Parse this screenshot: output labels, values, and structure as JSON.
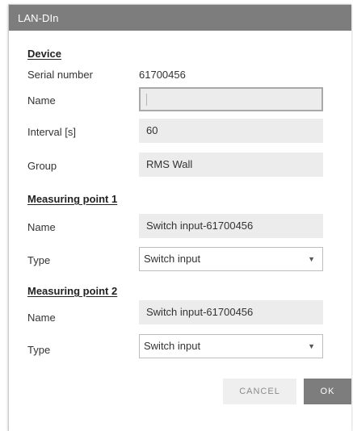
{
  "dialog": {
    "title": "LAN-DIn"
  },
  "device": {
    "section_title": "Device",
    "serial_label": "Serial number",
    "serial_value": "61700456",
    "name_label": "Name",
    "name_value": "",
    "interval_label": "Interval [s]",
    "interval_value": "60",
    "group_label": "Group",
    "group_value": "RMS Wall"
  },
  "measuring_point_1": {
    "section_title": "Measuring point 1",
    "name_label": "Name",
    "name_value": "Switch input-61700456",
    "type_label": "Type",
    "type_value": "Switch input"
  },
  "measuring_point_2": {
    "section_title": "Measuring point 2",
    "name_label": "Name",
    "name_value": "Switch input-61700456",
    "type_label": "Type",
    "type_value": "Switch input"
  },
  "buttons": {
    "cancel_label": "CANCEL",
    "ok_label": "OK"
  },
  "icons": {
    "select_arrow": "dropdown-arrow-icon"
  },
  "colors": {
    "titlebar": "#7d7d7d",
    "field_background": "#ececec",
    "ok_button": "#7d7d7d",
    "cancel_button": "#efefef"
  }
}
